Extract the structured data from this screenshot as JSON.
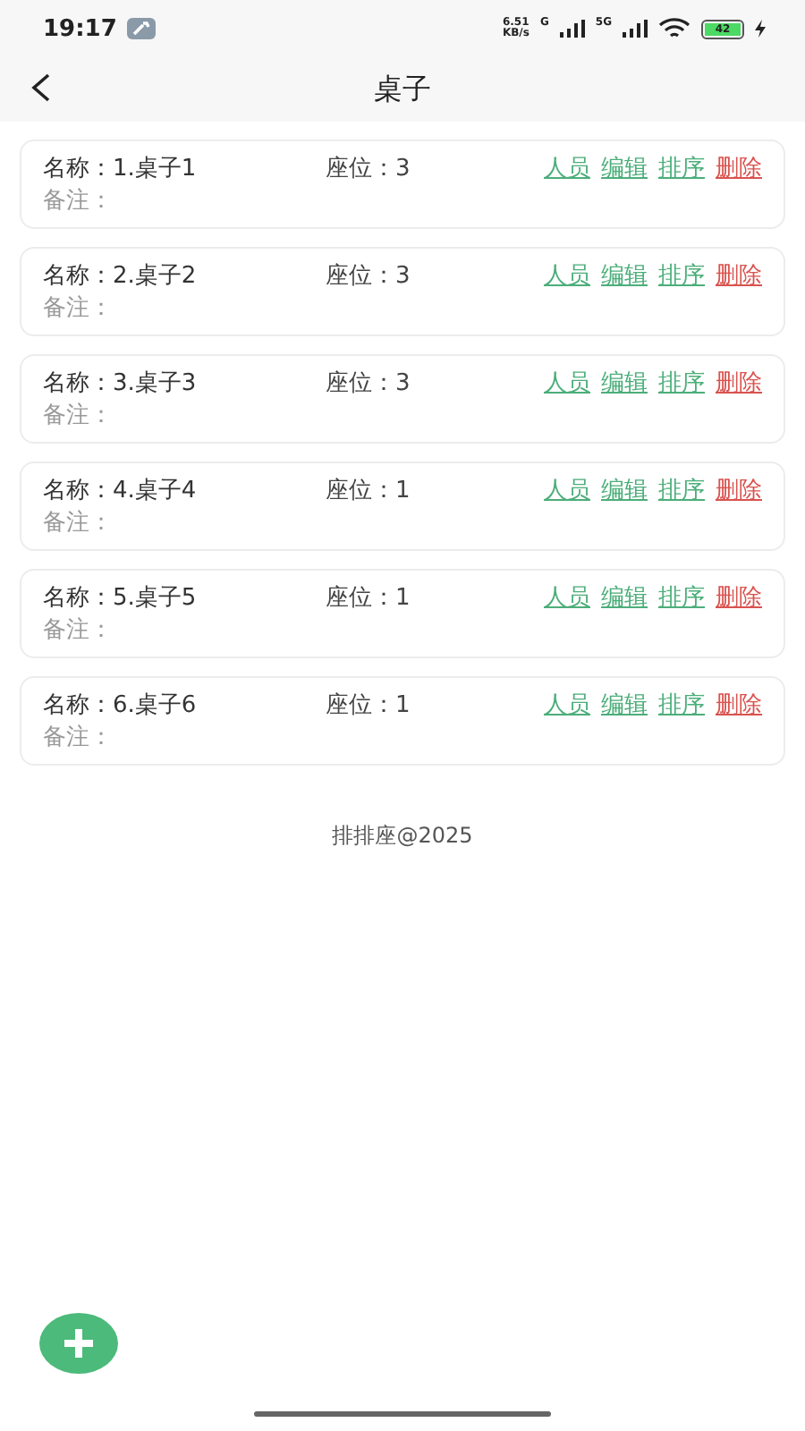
{
  "status_bar": {
    "time": "19:17",
    "speed_value": "6.51",
    "speed_unit": "KB/s",
    "sim1_label": "G",
    "sim2_label": "5G",
    "battery": "42"
  },
  "header": {
    "title": "桌子"
  },
  "tables": [
    {
      "name_label": "名称：",
      "name": "1.桌子1",
      "seats_label": "座位：",
      "seats": "3",
      "note_label": "备注：",
      "actions": [
        {
          "label": "人员",
          "kind": "normal"
        },
        {
          "label": "编辑",
          "kind": "normal"
        },
        {
          "label": "排序",
          "kind": "normal"
        },
        {
          "label": "删除",
          "kind": "danger"
        }
      ]
    },
    {
      "name_label": "名称：",
      "name": "2.桌子2",
      "seats_label": "座位：",
      "seats": "3",
      "note_label": "备注：",
      "actions": [
        {
          "label": "人员",
          "kind": "normal"
        },
        {
          "label": "编辑",
          "kind": "normal"
        },
        {
          "label": "排序",
          "kind": "normal"
        },
        {
          "label": "删除",
          "kind": "danger"
        }
      ]
    },
    {
      "name_label": "名称：",
      "name": "3.桌子3",
      "seats_label": "座位：",
      "seats": "3",
      "note_label": "备注：",
      "actions": [
        {
          "label": "人员",
          "kind": "normal"
        },
        {
          "label": "编辑",
          "kind": "normal"
        },
        {
          "label": "排序",
          "kind": "normal"
        },
        {
          "label": "删除",
          "kind": "danger"
        }
      ]
    },
    {
      "name_label": "名称：",
      "name": "4.桌子4",
      "seats_label": "座位：",
      "seats": "1",
      "note_label": "备注：",
      "actions": [
        {
          "label": "人员",
          "kind": "normal"
        },
        {
          "label": "编辑",
          "kind": "normal"
        },
        {
          "label": "排序",
          "kind": "normal"
        },
        {
          "label": "删除",
          "kind": "danger"
        }
      ]
    },
    {
      "name_label": "名称：",
      "name": "5.桌子5",
      "seats_label": "座位：",
      "seats": "1",
      "note_label": "备注：",
      "actions": [
        {
          "label": "人员",
          "kind": "normal"
        },
        {
          "label": "编辑",
          "kind": "normal"
        },
        {
          "label": "排序",
          "kind": "normal"
        },
        {
          "label": "删除",
          "kind": "danger"
        }
      ]
    },
    {
      "name_label": "名称：",
      "name": "6.桌子6",
      "seats_label": "座位：",
      "seats": "1",
      "note_label": "备注：",
      "actions": [
        {
          "label": "人员",
          "kind": "normal"
        },
        {
          "label": "编辑",
          "kind": "normal"
        },
        {
          "label": "排序",
          "kind": "normal"
        },
        {
          "label": "删除",
          "kind": "danger"
        }
      ]
    }
  ],
  "footer": "排排座@2025"
}
